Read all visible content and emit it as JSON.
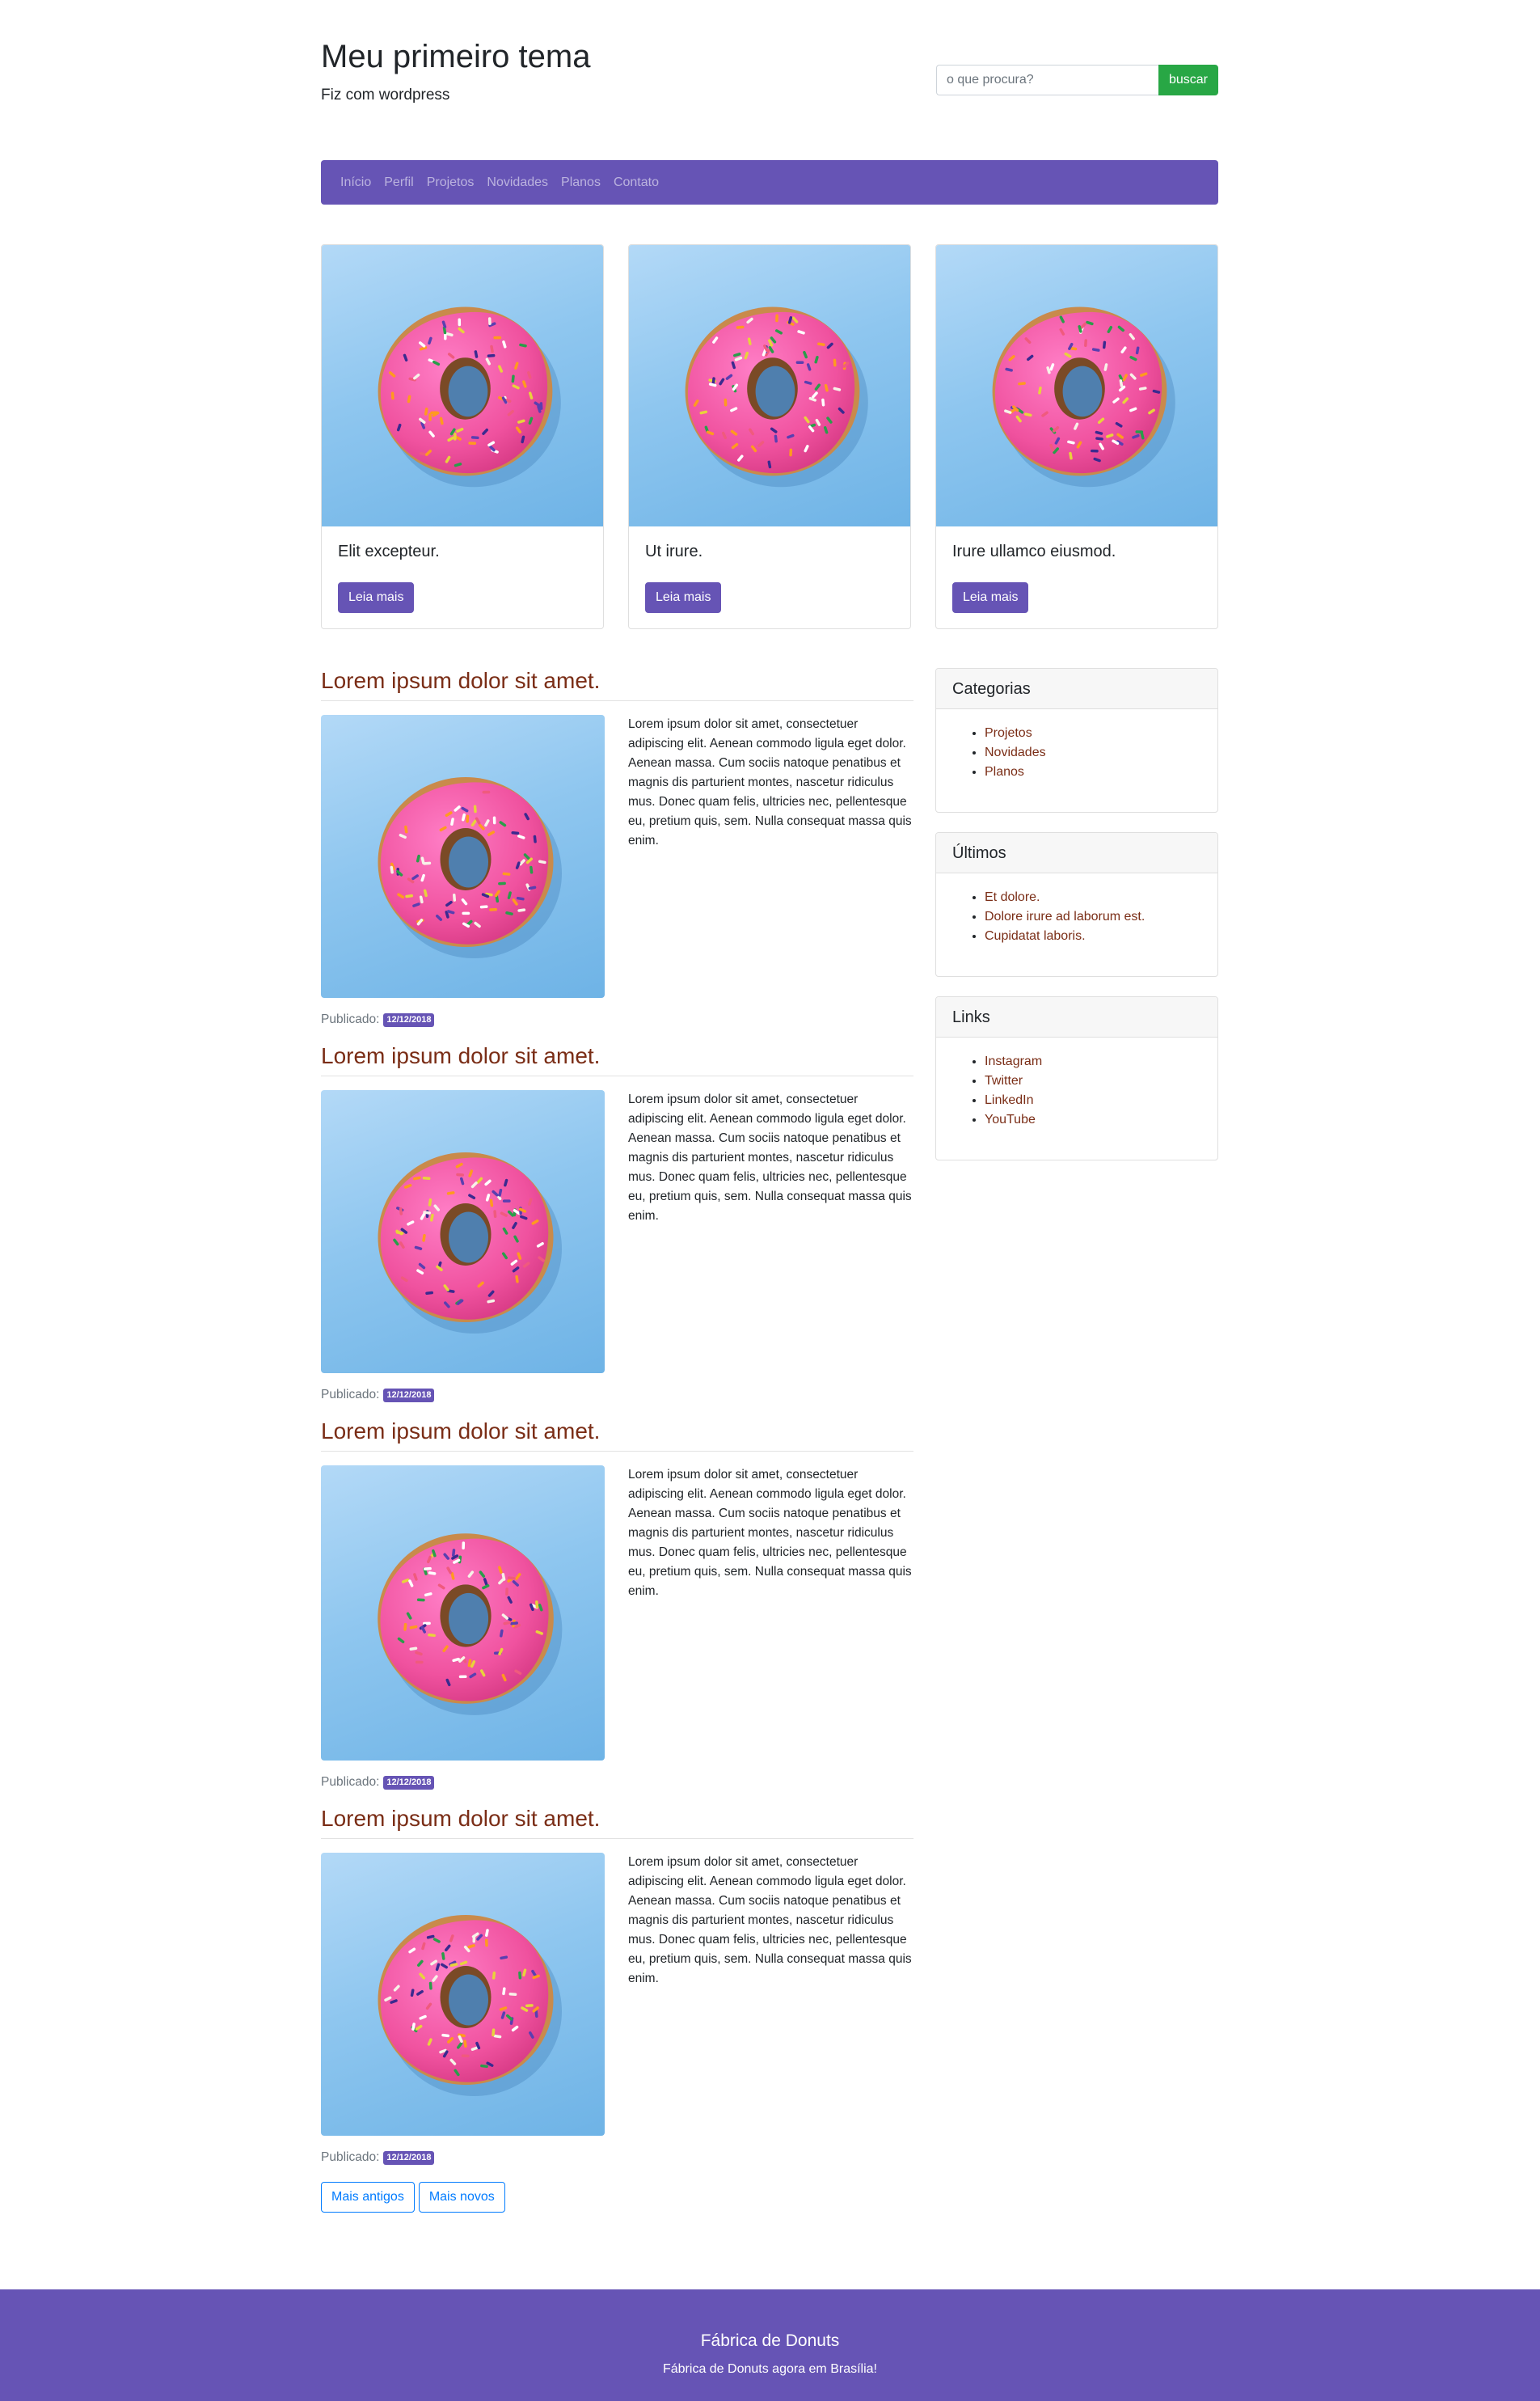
{
  "header": {
    "title": "Meu primeiro tema",
    "description": "Fiz com wordpress",
    "search_placeholder": "o que procura?",
    "search_button": "buscar"
  },
  "nav": {
    "items": [
      "Início",
      "Perfil",
      "Projetos",
      "Novidades",
      "Planos",
      "Contato"
    ]
  },
  "featured": [
    {
      "title": "Elit excepteur.",
      "button": "Leia mais"
    },
    {
      "title": "Ut irure.",
      "button": "Leia mais"
    },
    {
      "title": "Irure ullamco eiusmod.",
      "button": "Leia mais"
    }
  ],
  "posts": [
    {
      "title": "Lorem ipsum dolor sit amet.",
      "excerpt": "Lorem ipsum dolor sit amet, consectetuer adipiscing elit. Aenean commodo ligula eget dolor. Aenean massa. Cum sociis natoque penatibus et magnis dis parturient montes, nascetur ridiculus mus. Donec quam felis, ultricies nec, pellentesque eu, pretium quis, sem. Nulla consequat massa quis enim.",
      "published_label": "Publicado:",
      "date": "12/12/2018"
    },
    {
      "title": "Lorem ipsum dolor sit amet.",
      "excerpt": "Lorem ipsum dolor sit amet, consectetuer adipiscing elit. Aenean commodo ligula eget dolor. Aenean massa. Cum sociis natoque penatibus et magnis dis parturient montes, nascetur ridiculus mus. Donec quam felis, ultricies nec, pellentesque eu, pretium quis, sem. Nulla consequat massa quis enim.",
      "published_label": "Publicado:",
      "date": "12/12/2018"
    },
    {
      "title": "Lorem ipsum dolor sit amet.",
      "excerpt": "Lorem ipsum dolor sit amet, consectetuer adipiscing elit. Aenean commodo ligula eget dolor. Aenean massa. Cum sociis natoque penatibus et magnis dis parturient montes, nascetur ridiculus mus. Donec quam felis, ultricies nec, pellentesque eu, pretium quis, sem. Nulla consequat massa quis enim.",
      "published_label": "Publicado:",
      "date": "12/12/2018"
    },
    {
      "title": "Lorem ipsum dolor sit amet.",
      "excerpt": "Lorem ipsum dolor sit amet, consectetuer adipiscing elit. Aenean commodo ligula eget dolor. Aenean massa. Cum sociis natoque penatibus et magnis dis parturient montes, nascetur ridiculus mus. Donec quam felis, ultricies nec, pellentesque eu, pretium quis, sem. Nulla consequat massa quis enim.",
      "published_label": "Publicado:",
      "date": "12/12/2018"
    }
  ],
  "pagination": {
    "older": "Mais antigos",
    "newer": "Mais novos"
  },
  "sidebar": {
    "categories": {
      "title": "Categorias",
      "items": [
        "Projetos",
        "Novidades",
        "Planos"
      ]
    },
    "latest": {
      "title": "Últimos",
      "items": [
        "Et dolore.",
        "Dolore irure ad laborum est.",
        "Cupidatat laboris."
      ]
    },
    "links": {
      "title": "Links",
      "items": [
        "Instagram",
        "Twitter",
        "LinkedIn",
        "YouTube"
      ]
    }
  },
  "footer": {
    "title": "Fábrica de Donuts",
    "subtitle": "Fábrica de Donuts agora em Brasília!"
  },
  "colors": {
    "brand_purple": "#6654b5",
    "link_brown": "#7a2d16",
    "search_green": "#28a745",
    "outline_blue": "#007bff"
  },
  "icons": {
    "post_image": "pink-donut-image"
  }
}
